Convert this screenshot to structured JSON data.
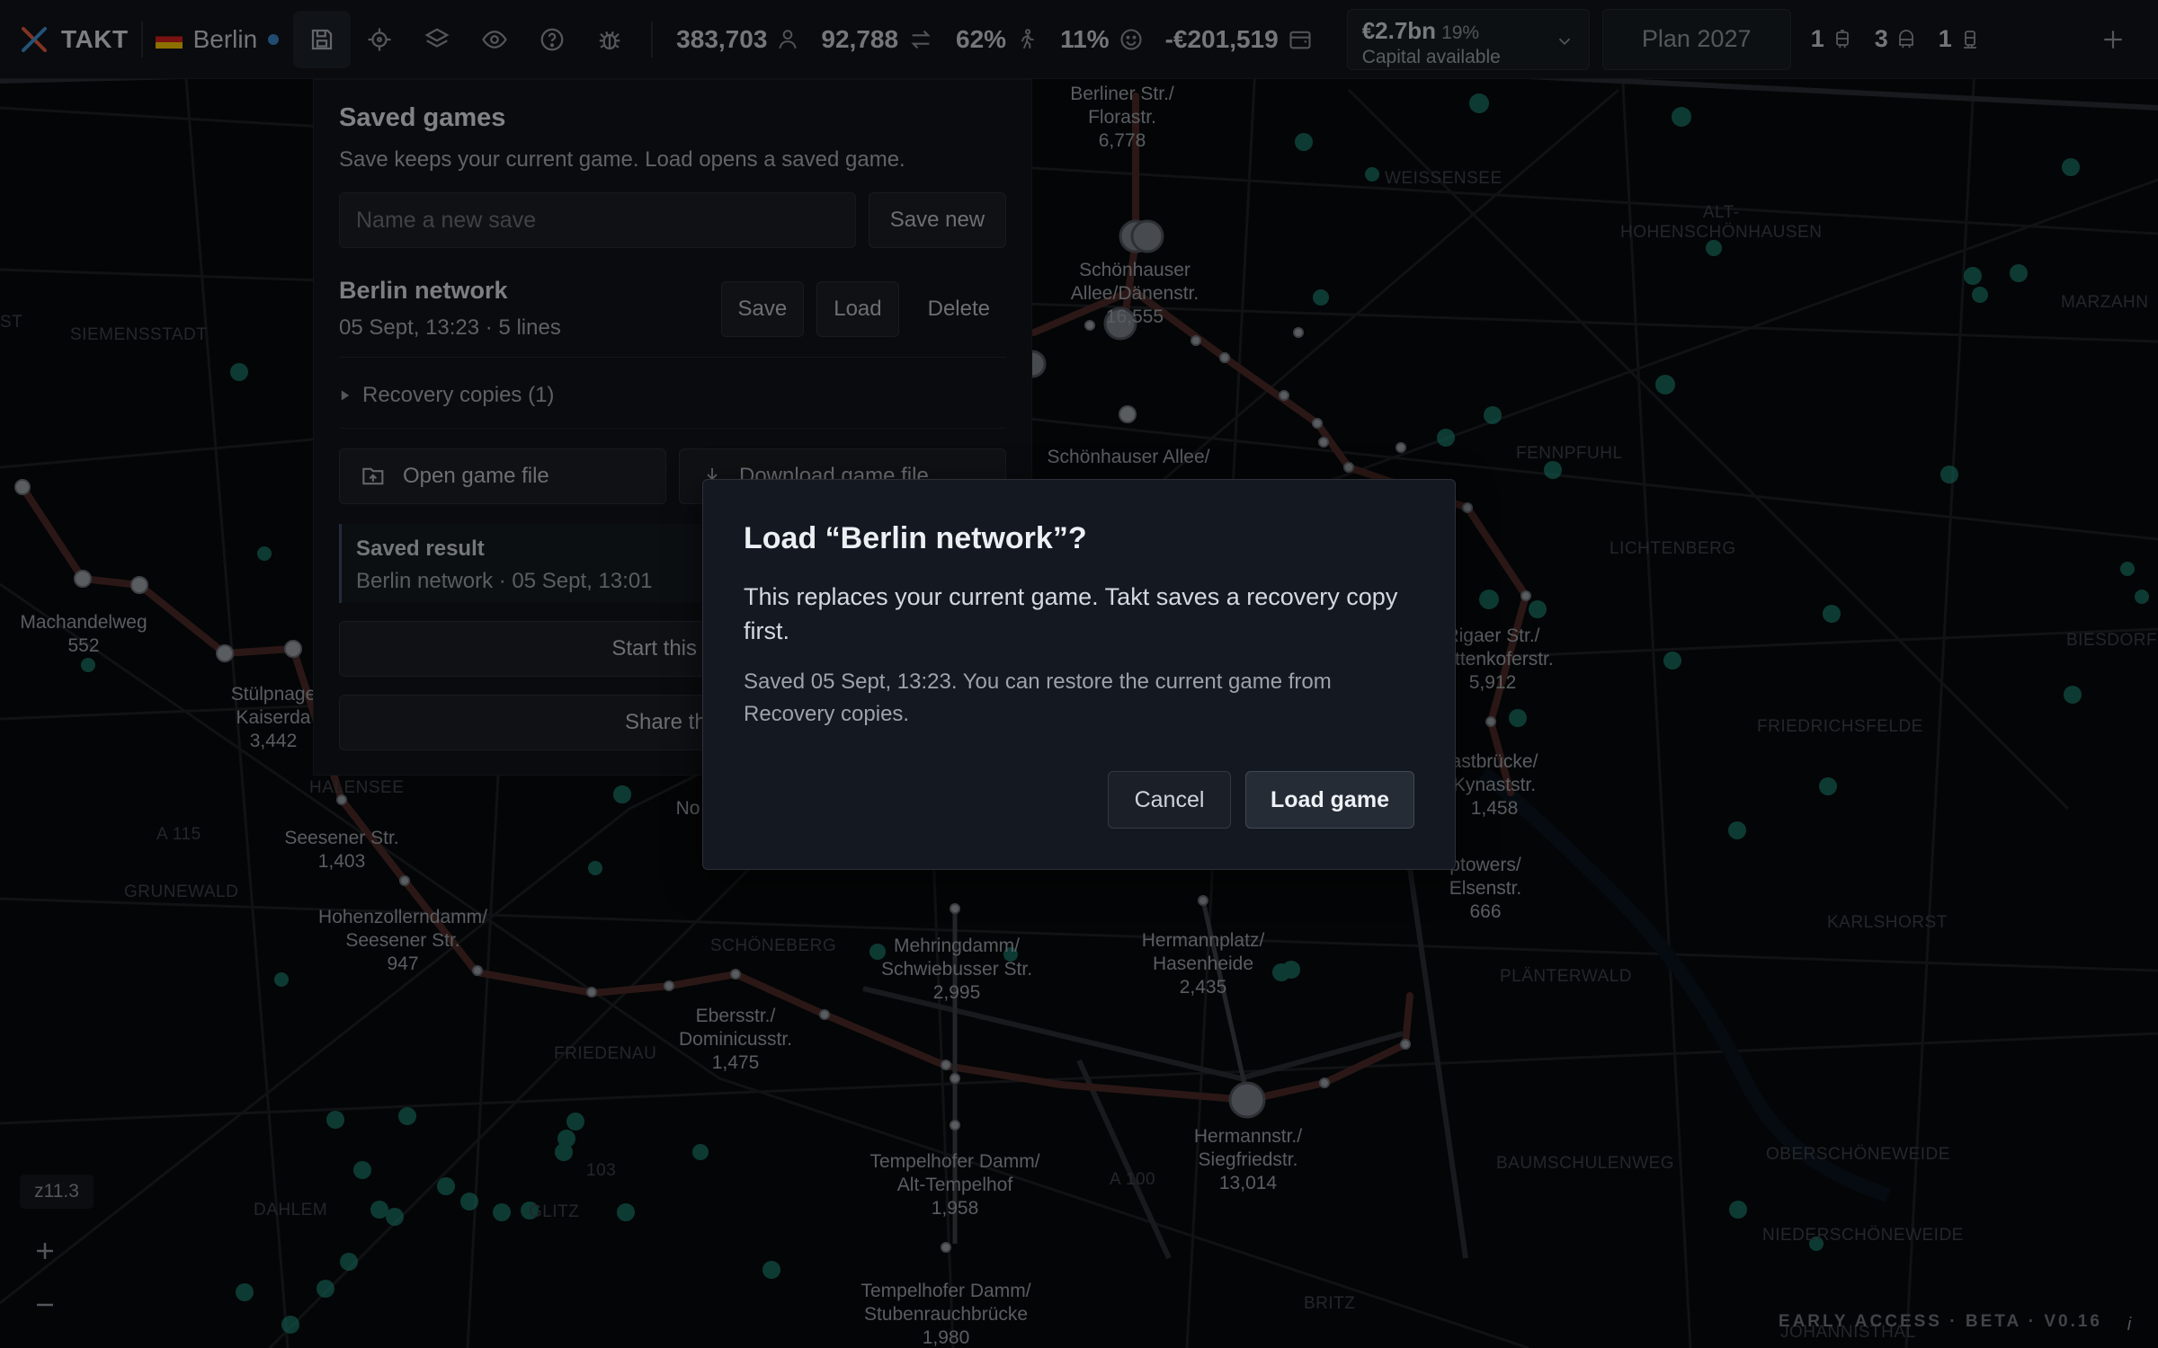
{
  "topbar": {
    "app_name": "TAKT",
    "city": "Berlin",
    "stats": [
      {
        "value": "383,703",
        "icon": "person-icon"
      },
      {
        "value": "92,788",
        "icon": "transfer-icon"
      },
      {
        "value": "62%",
        "icon": "walking-icon"
      },
      {
        "value": "11%",
        "icon": "smiley-icon"
      },
      {
        "value": "-€201,519",
        "icon": "wallet-icon"
      }
    ],
    "capital": {
      "amount": "€2.7bn",
      "percent": "19%",
      "label": "Capital available"
    },
    "plan_label": "Plan 2027",
    "vehicle_counts": [
      {
        "value": "1",
        "icon": "tram-icon"
      },
      {
        "value": "3",
        "icon": "subway-icon"
      },
      {
        "value": "1",
        "icon": "train-icon"
      }
    ]
  },
  "saved_panel": {
    "title": "Saved games",
    "description": "Save keeps your current game. Load opens a saved game.",
    "name_placeholder": "Name a new save",
    "save_new_label": "Save new",
    "save": {
      "name": "Berlin network",
      "meta": "05 Sept, 13:23 · 5 lines"
    },
    "save_label": "Save",
    "load_label": "Load",
    "delete_label": "Delete",
    "recovery_label": "Recovery copies (1)",
    "open_file_label": "Open game file",
    "download_file_label": "Download game file",
    "saved_result_title": "Saved result",
    "saved_result_sub": "Berlin network · 05 Sept, 13:01",
    "start_city_label": "Start this city",
    "share_label": "Share this"
  },
  "dialog": {
    "title": "Load “Berlin network”?",
    "body": "This replaces your current game. Takt saves a recovery copy first.",
    "note": "Saved 05 Sept, 13:23. You can restore the current game from Recovery copies.",
    "cancel_label": "Cancel",
    "load_label": "Load game"
  },
  "map": {
    "zoom_level": "z11.3",
    "stations": [
      {
        "name": "Berliner Str./\nFlorastr.",
        "value": "6,778"
      },
      {
        "name": "Schönhauser\nAllee/Dänenstr.",
        "value": "16,555"
      },
      {
        "name": "Schönhauser Allee/",
        "value": ""
      },
      {
        "name": "Machandelweg",
        "value": "552"
      },
      {
        "name": "Stülpnage\nKaiserda",
        "value": "3,442"
      },
      {
        "name": "Seesener Str.",
        "value": "1,403"
      },
      {
        "name": "Hohenzollerndamm/\nSeesener Str.",
        "value": "947"
      },
      {
        "name": "Mehringdamm/\nSchwiebusser Str.",
        "value": "2,995"
      },
      {
        "name": "Ebersstr./\nDominicusstr.",
        "value": "1,475"
      },
      {
        "name": "Hermannplatz/\nHasenheide",
        "value": "2,435"
      },
      {
        "name": "Hermannstr./\nSiegfriedstr.",
        "value": "13,014"
      },
      {
        "name": "Tempelhofer Damm/\nAlt-Tempelhof",
        "value": "1,958"
      },
      {
        "name": "Tempelhofer Damm/\nStubenrauchbrücke",
        "value": "1,980"
      },
      {
        "name": "Rigaer Str./\nPettenkoferstr.",
        "value": "5,912"
      },
      {
        "name": "astbrücke/\nKynaststr.",
        "value": "1,458"
      },
      {
        "name": "ptowers/\nElsenstr.",
        "value": "666"
      },
      {
        "name": "No",
        "value": ""
      }
    ],
    "districts": [
      "SIEMENSSTADT",
      "WEISSENSEE",
      "ALT-\nHOHENSCHÖNHAUSEN",
      "MARZAHN",
      "FENNPFUHL",
      "LICHTENBERG",
      "BIESDORF",
      "FRIEDRICHSFELDE",
      "KARLSHORST",
      "PLÄNTERWALD",
      "BAUMSCHULENWEG",
      "OBERSCHÖNEWEIDE",
      "NIEDERSCHÖNEWEIDE",
      "JOHANNISTHAL",
      "BRITZ",
      "SCHÖNEBERG",
      "FRIEDENAU",
      "GRUNEWALD",
      "DAHLEM",
      "HALENSEE",
      "GLITZ",
      "A 115",
      "A 100",
      "ST",
      "103"
    ],
    "footer": "EARLY ACCESS · BETA · V0.16"
  }
}
